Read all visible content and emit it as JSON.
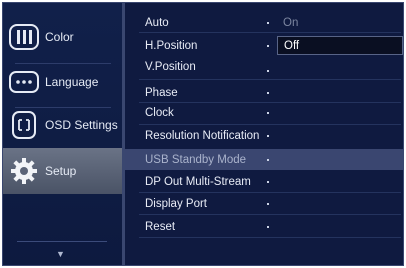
{
  "sidebar": {
    "tabs": [
      {
        "label": "Color",
        "icon": "color-bars-icon"
      },
      {
        "label": "Language",
        "icon": "language-dots-icon"
      },
      {
        "label": "OSD Settings",
        "icon": "osd-settings-icon"
      },
      {
        "label": "Setup",
        "icon": "gear-icon"
      }
    ],
    "active": "Setup"
  },
  "menu": {
    "items": [
      {
        "label": "Auto",
        "value": "On"
      },
      {
        "label": "H.Position",
        "value": ""
      },
      {
        "label": "V.Position",
        "value": ""
      },
      {
        "label": "Phase",
        "value": ""
      },
      {
        "label": "Clock",
        "value": ""
      },
      {
        "label": "Resolution Notification",
        "value": ""
      },
      {
        "label": "USB Standby Mode",
        "value": ""
      },
      {
        "label": "DP Out Multi-Stream",
        "value": ""
      },
      {
        "label": "Display Port",
        "value": ""
      },
      {
        "label": "Reset",
        "value": ""
      }
    ],
    "selected_option": "Off"
  },
  "colors": {
    "background": "#0f1a40",
    "active_tab": "#5b6478",
    "highlight_row": "#3a4670"
  }
}
